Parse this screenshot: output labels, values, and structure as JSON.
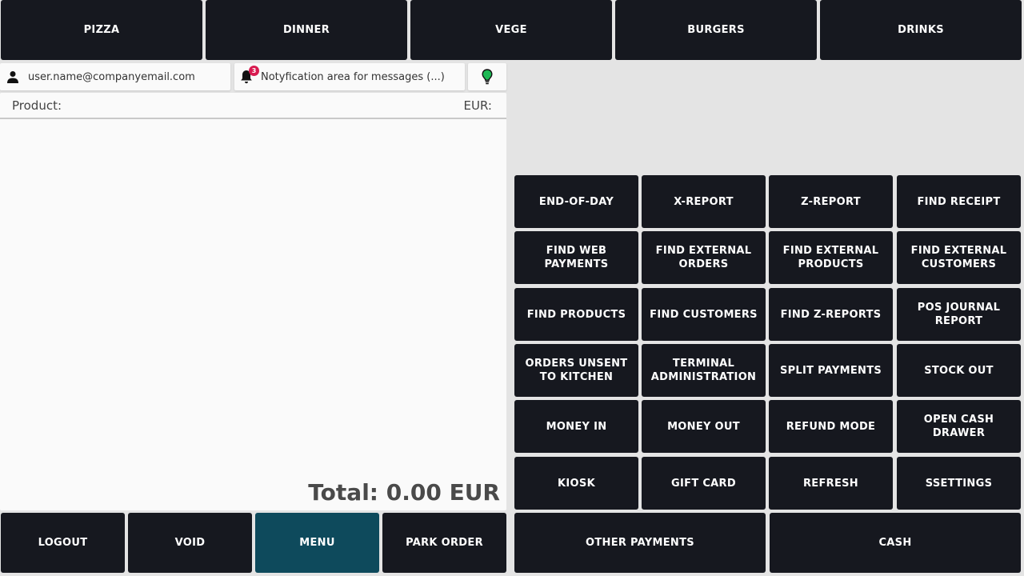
{
  "categories": [
    "PIZZA",
    "DINNER",
    "VEGE",
    "BURGERS",
    "DRINKS"
  ],
  "info_bar": {
    "user_email": "user.name@companyemail.com",
    "notification_text": "Notyfication area for messages (...)",
    "notification_count": "3",
    "status_color": "#1db954"
  },
  "order": {
    "product_header": "Product:",
    "currency_header": "EUR:",
    "total": "Total: 0.00 EUR"
  },
  "functions": [
    [
      "END-OF-DAY"
    ],
    [
      "X-REPORT"
    ],
    [
      "Z-REPORT"
    ],
    [
      "FIND RECEIPT"
    ],
    [
      "FIND WEB",
      "PAYMENTS"
    ],
    [
      "FIND EXTERNAL",
      "ORDERS"
    ],
    [
      "FIND EXTERNAL",
      "PRODUCTS"
    ],
    [
      "FIND EXTERNAL",
      "CUSTOMERS"
    ],
    [
      "FIND PRODUCTS"
    ],
    [
      "FIND CUSTOMERS"
    ],
    [
      "FIND Z-REPORTS"
    ],
    [
      "POS JOURNAL",
      "REPORT"
    ],
    [
      "ORDERS UNSENT",
      "TO KITCHEN"
    ],
    [
      "TERMINAL",
      "ADMINISTRATION"
    ],
    [
      "SPLIT PAYMENTS"
    ],
    [
      "STOCK OUT"
    ],
    [
      "MONEY IN"
    ],
    [
      "MONEY OUT"
    ],
    [
      "REFUND MODE"
    ],
    [
      "OPEN CASH",
      "DRAWER"
    ],
    [
      "KIOSK"
    ],
    [
      "GIFT CARD"
    ],
    [
      "REFRESH"
    ],
    [
      "SSETTINGS"
    ]
  ],
  "bottom": {
    "logout": "LOGOUT",
    "void": "VOID",
    "menu": "MENU",
    "park_order": "PARK ORDER",
    "other_payments": "OTHER PAYMENTS",
    "cash": "CASH"
  },
  "colors": {
    "button_bg": "#16181f",
    "menu_active_bg": "#0e4a5c",
    "badge": "#d81b50"
  }
}
